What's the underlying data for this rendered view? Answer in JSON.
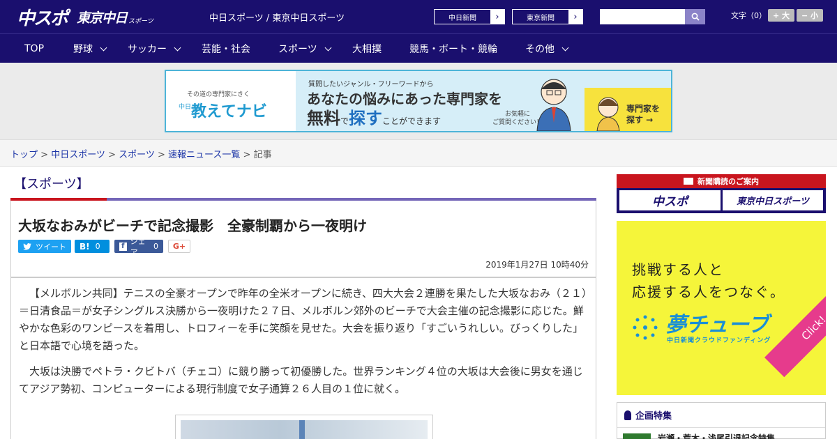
{
  "header": {
    "logo_main": "中スポ",
    "logo_tokyo": "東京中日",
    "logo_sports": "スポーツ",
    "site_title": "中日スポーツ / 東京中日スポーツ",
    "ext_links": [
      "中日新聞",
      "東京新聞"
    ],
    "search_placeholder": "",
    "font_label": "文字（0）",
    "font_plus": "+ 大",
    "font_minus": "− 小"
  },
  "nav": {
    "items": [
      {
        "label": "TOP",
        "dropdown": false
      },
      {
        "label": "野球",
        "dropdown": true
      },
      {
        "label": "サッカー",
        "dropdown": true
      },
      {
        "label": "芸能・社会",
        "dropdown": false
      },
      {
        "label": "スポーツ",
        "dropdown": true
      },
      {
        "label": "大相撲",
        "dropdown": false
      },
      {
        "label": "競馬・ボート・競輪",
        "dropdown": false
      },
      {
        "label": "その他",
        "dropdown": true
      }
    ]
  },
  "ad_banner": {
    "small_text": "その道の専門家にきく",
    "brand_prefix": "中日",
    "brand": "教えてナビ",
    "question": "質問したいジャンル・フリーワードから",
    "headline1": "あなたの悩みにあった専門家を",
    "headline2_a": "無料",
    "headline2_b": "で",
    "headline2_c": "探す",
    "headline2_d": "ことができます",
    "note": "お気軽に\nご質問ください！",
    "cta": "専門家を\n探す →"
  },
  "breadcrumb": {
    "items": [
      "トップ",
      "中日スポーツ",
      "スポーツ",
      "速報ニュース一覧"
    ],
    "current": "記事"
  },
  "article": {
    "category": "【スポーツ】",
    "title": "大坂なおみがビーチで記念撮影　全豪制覇から一夜明け",
    "share": {
      "tweet": "ツイート",
      "hatena_count": "0",
      "fb_label": "シェア",
      "fb_count": "0",
      "gplus": "G+"
    },
    "date": "2019年1月27日 10時40分",
    "paragraphs": [
      "【メルボルン共同】テニスの全豪オープンで昨年の全米オープンに続き、四大大会２連勝を果たした大坂なおみ（２１）＝日清食品＝が女子シングルス決勝から一夜明けた２７日、メルボルン郊外のビーチで大会主催の記念撮影に応じた。鮮やかな色彩のワンピースを着用し、トロフィーを手に笑顔を見せた。大会を振り返り「すごいうれしい。びっくりした」と日本語で心境を語った。",
      "大坂は決勝でペトラ・クビトバ（チェコ）に競り勝って初優勝した。世界ランキング４位の大坂は大会後に男女を通じてアジア勢初、コンピューターによる現行制度で女子通算２６人目の１位に就く。"
    ]
  },
  "sidebar": {
    "subscribe_title": "新聞購読のご案内",
    "subscribe_a": "中スポ",
    "subscribe_b": "東京中日スポーツ",
    "yume_line1": "挑戦する人と",
    "yume_line2": "応援する人をつなぐ。",
    "yume_logo": "夢チューブ",
    "yume_sub": "中日新聞クラウドファンディング",
    "yume_click": "Click!",
    "feature_title": "企画特集",
    "feature_item": "岩瀬・荒木・浅尾引退記念特集"
  },
  "colors": {
    "brand_navy": "#1a0f6e",
    "accent_red": "#c9151e",
    "twitter": "#1da1f2",
    "hatena": "#008fde",
    "facebook": "#3b5998"
  }
}
